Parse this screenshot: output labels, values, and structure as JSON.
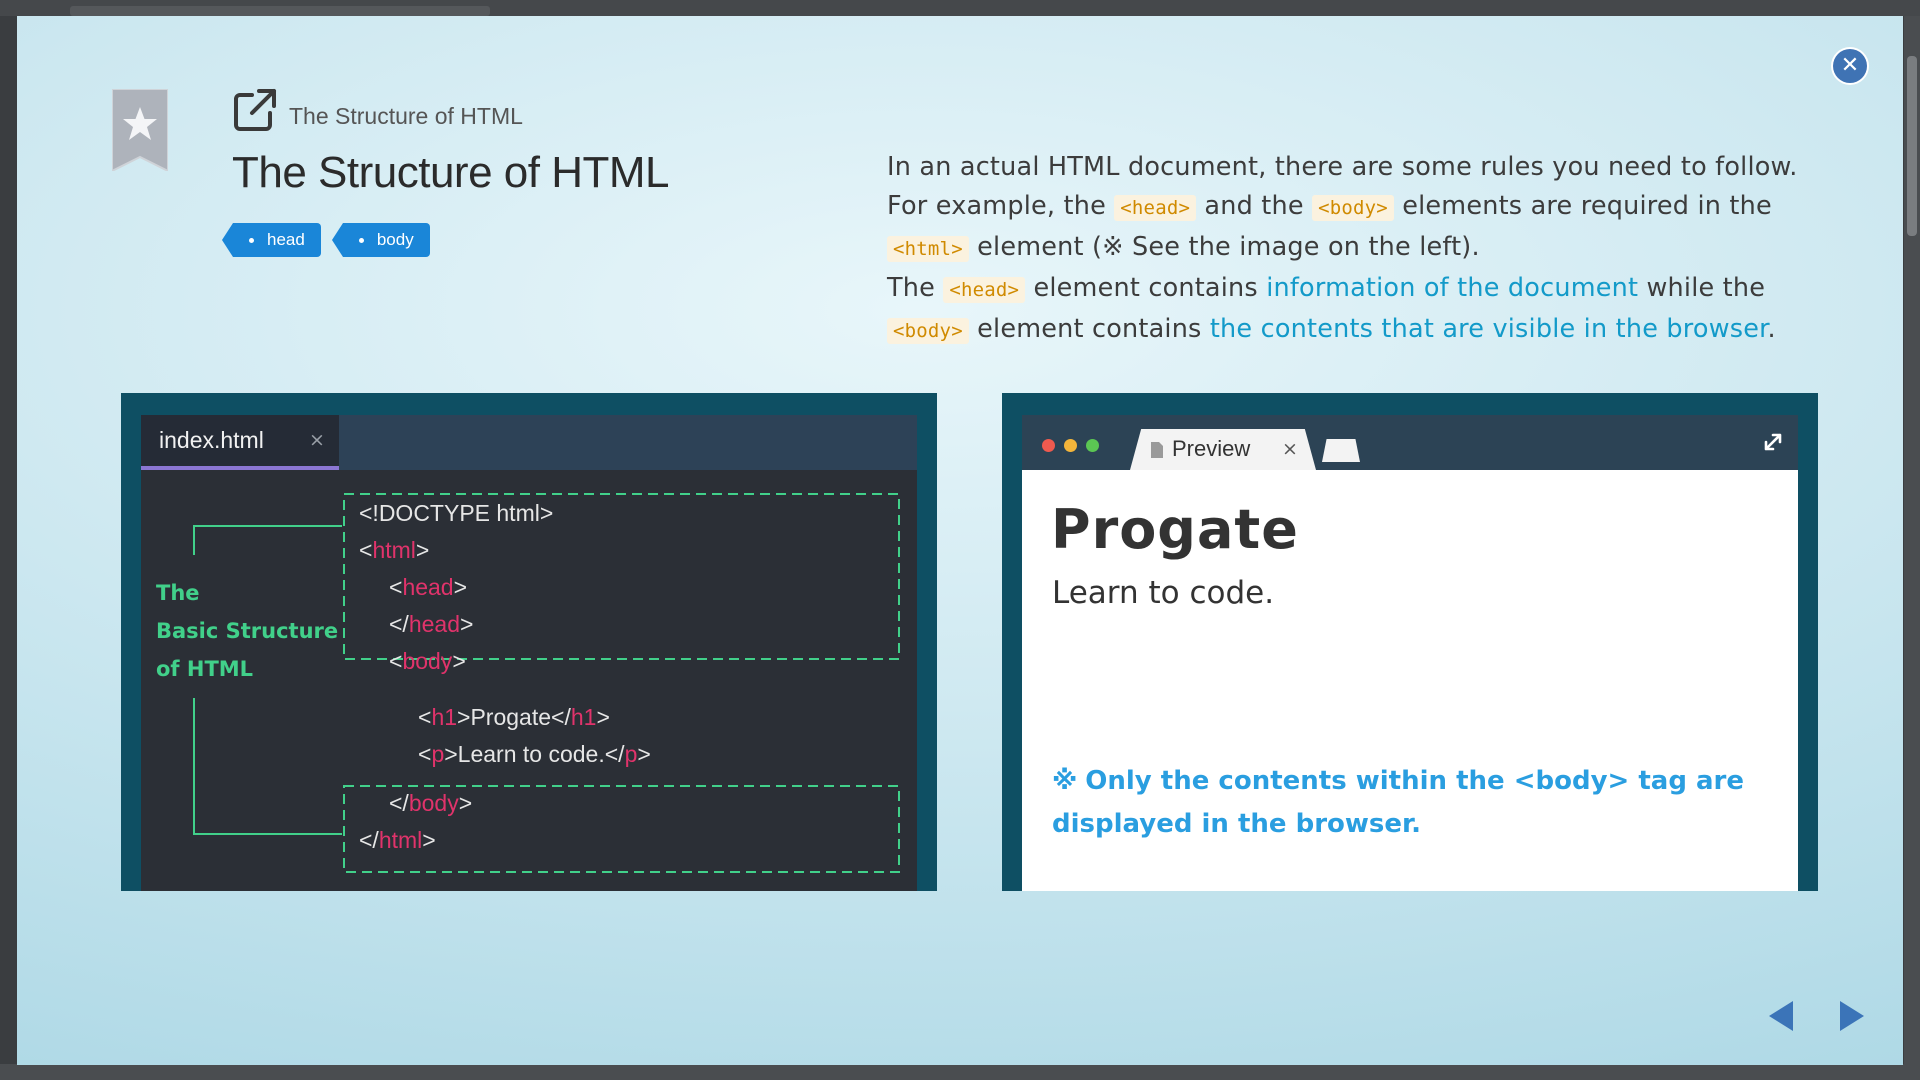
{
  "header": {
    "breadcrumb": "The Structure of HTML",
    "title": "The Structure of HTML",
    "tags": [
      "head",
      "body"
    ]
  },
  "description": {
    "line1": "In an actual HTML document, there are some rules you need to follow.",
    "line2_pre": "For example, the ",
    "chip_head": "<head>",
    "line2_mid": " and the ",
    "chip_body": "<body>",
    "line2_post": " elements are required in the",
    "chip_html": "<html>",
    "line3_post": " element (※ See the image on the left).",
    "line4_pre": "The ",
    "line4_mid": " element contains ",
    "line4_link": "information of the document",
    "line4_post": " while the",
    "line5_mid": " element contains ",
    "line5_link": "the contents that are visible in the browser",
    "line5_end": "."
  },
  "editor": {
    "tab_name": "index.html",
    "tab_close": "×",
    "side_label": [
      "The",
      "Basic Structure",
      "of HTML"
    ],
    "code": {
      "doctype": "<!DOCTYPE html>",
      "lt": "<",
      "gt": ">",
      "lt_slash": "</",
      "html": "html",
      "head": "head",
      "body": "body",
      "h1": "h1",
      "p": "p",
      "h1_text": "Progate",
      "p_text": "Learn to code."
    }
  },
  "preview": {
    "tab_name": "Preview",
    "tab_close": "×",
    "heading": "Progate",
    "text": "Learn to code.",
    "note_mark": "※",
    "note": "Only the contents within the <body> tag are displayed in the browser."
  },
  "icons": {
    "close": "close-icon",
    "bookmark": "bookmark-star-icon",
    "link": "external-link-icon",
    "expand": "expand-icon",
    "prev": "prev-arrow-icon",
    "next": "next-arrow-icon"
  },
  "colors": {
    "accent_blue": "#1a86d8",
    "link": "#139ac9",
    "code_chip": "#d08a00",
    "tag_red": "#e0336b",
    "label_green": "#41d08a",
    "panel_teal": "#0e4f63"
  },
  "close_symbol": "✕"
}
